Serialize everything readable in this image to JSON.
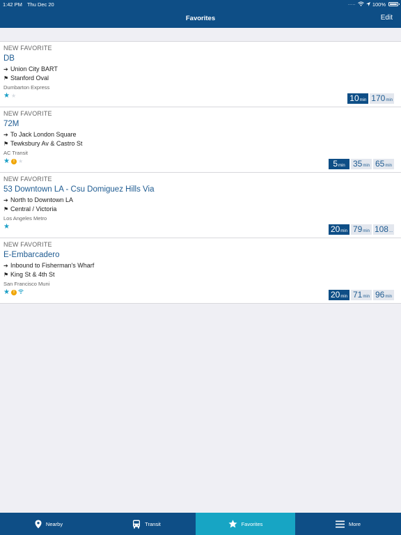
{
  "status_bar": {
    "time": "1:42 PM",
    "date": "Thu Dec 20",
    "battery": "100%",
    "signal": "....."
  },
  "header": {
    "title": "Favorites",
    "edit_label": "Edit"
  },
  "favorites": [
    {
      "kicker": "NEW FAVORITE",
      "route": "DB",
      "direction": "Union City BART",
      "stop": "Stanford Oval",
      "agency": "Dumbarton Express",
      "times": [
        {
          "value": "10",
          "unit": "min"
        },
        {
          "value": "170",
          "unit": "min"
        }
      ]
    },
    {
      "kicker": "NEW FAVORITE",
      "route": "72M",
      "direction": "To Jack London Square",
      "stop": "Tewksbury Av & Castro St",
      "agency": "AC Transit",
      "times": [
        {
          "value": "5",
          "unit": "min"
        },
        {
          "value": "35",
          "unit": "min"
        },
        {
          "value": "65",
          "unit": "min"
        }
      ]
    },
    {
      "kicker": "NEW FAVORITE",
      "route": "53 Downtown LA - Csu Domiguez Hills Via",
      "direction": "North to Downtown LA",
      "stop": "Central / Victoria",
      "agency": "Los Angeles Metro",
      "times": [
        {
          "value": "20",
          "unit": "min"
        },
        {
          "value": "79",
          "unit": "min"
        },
        {
          "value": "108",
          "unit": "..."
        }
      ]
    },
    {
      "kicker": "NEW FAVORITE",
      "route": "E-Embarcadero",
      "direction": "Inbound to Fisherman's Wharf",
      "stop": "King St & 4th St",
      "agency": "San Francisco Muni",
      "times": [
        {
          "value": "20",
          "unit": "min"
        },
        {
          "value": "71",
          "unit": "min"
        },
        {
          "value": "96",
          "unit": "min"
        }
      ]
    }
  ],
  "tabs": [
    {
      "label": "Nearby",
      "icon": "map-pin-icon",
      "active": false
    },
    {
      "label": "Transit",
      "icon": "bus-icon",
      "active": false
    },
    {
      "label": "Favorites",
      "icon": "star-icon",
      "active": true
    },
    {
      "label": "More",
      "icon": "menu-icon",
      "active": false
    }
  ],
  "colors": {
    "brand": "#0e4e86",
    "accent": "#17a5c4",
    "alert": "#f0a500"
  }
}
